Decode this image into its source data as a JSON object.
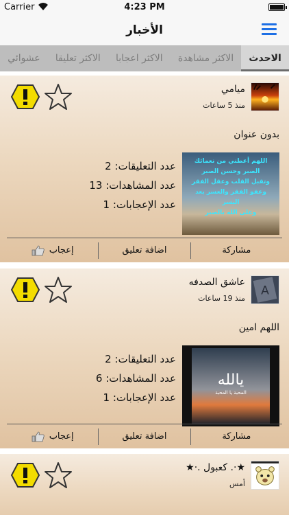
{
  "status_bar": {
    "carrier": "Carrier",
    "time": "4:23 PM"
  },
  "nav": {
    "title": "الأخبار",
    "menu_icon": "hamburger-menu-icon"
  },
  "tabs": [
    {
      "label": "عشوائي",
      "active": false
    },
    {
      "label": "الاكثر تعليقا",
      "active": false
    },
    {
      "label": "الاكثر اعجابا",
      "active": false
    },
    {
      "label": "الاكثر مشاهدة",
      "active": false
    },
    {
      "label": "الاحدث",
      "active": true
    }
  ],
  "posts": [
    {
      "author": "ميامي",
      "time": "منذ 5 ساعات",
      "text": "بدون عنوان",
      "comments_label": "عدد التعليقات:",
      "comments": "2",
      "views_label": "عدد المشاهدات:",
      "views": "13",
      "likes_label": "عدد الإعجابات:",
      "likes": "1",
      "image_text": [
        "اللهم أعطني من نعمائك",
        "الصبر وحسن الصبر",
        "وتقبل القلب وعقل الفقر",
        "وعفو الفقر والعسر بعد",
        "اليسر",
        "وعلى الله بالصبر"
      ],
      "share_label": "مشاركة",
      "comment_label": "اضافة تعليق",
      "like_label": "إعجاب"
    },
    {
      "author": "عاشق الصدفه",
      "time": "منذ 19 ساعات",
      "text": "اللهم امين",
      "comments_label": "عدد التعليقات:",
      "comments": "2",
      "views_label": "عدد المشاهدات:",
      "views": "6",
      "likes_label": "عدد الإعجابات:",
      "likes": "1",
      "image_text": [
        "يالله",
        "المحبة يا المحبة"
      ],
      "share_label": "مشاركة",
      "comment_label": "اضافة تعليق",
      "like_label": "إعجاب"
    },
    {
      "author": "★·. كعبول .·★",
      "time": "أمس"
    }
  ]
}
